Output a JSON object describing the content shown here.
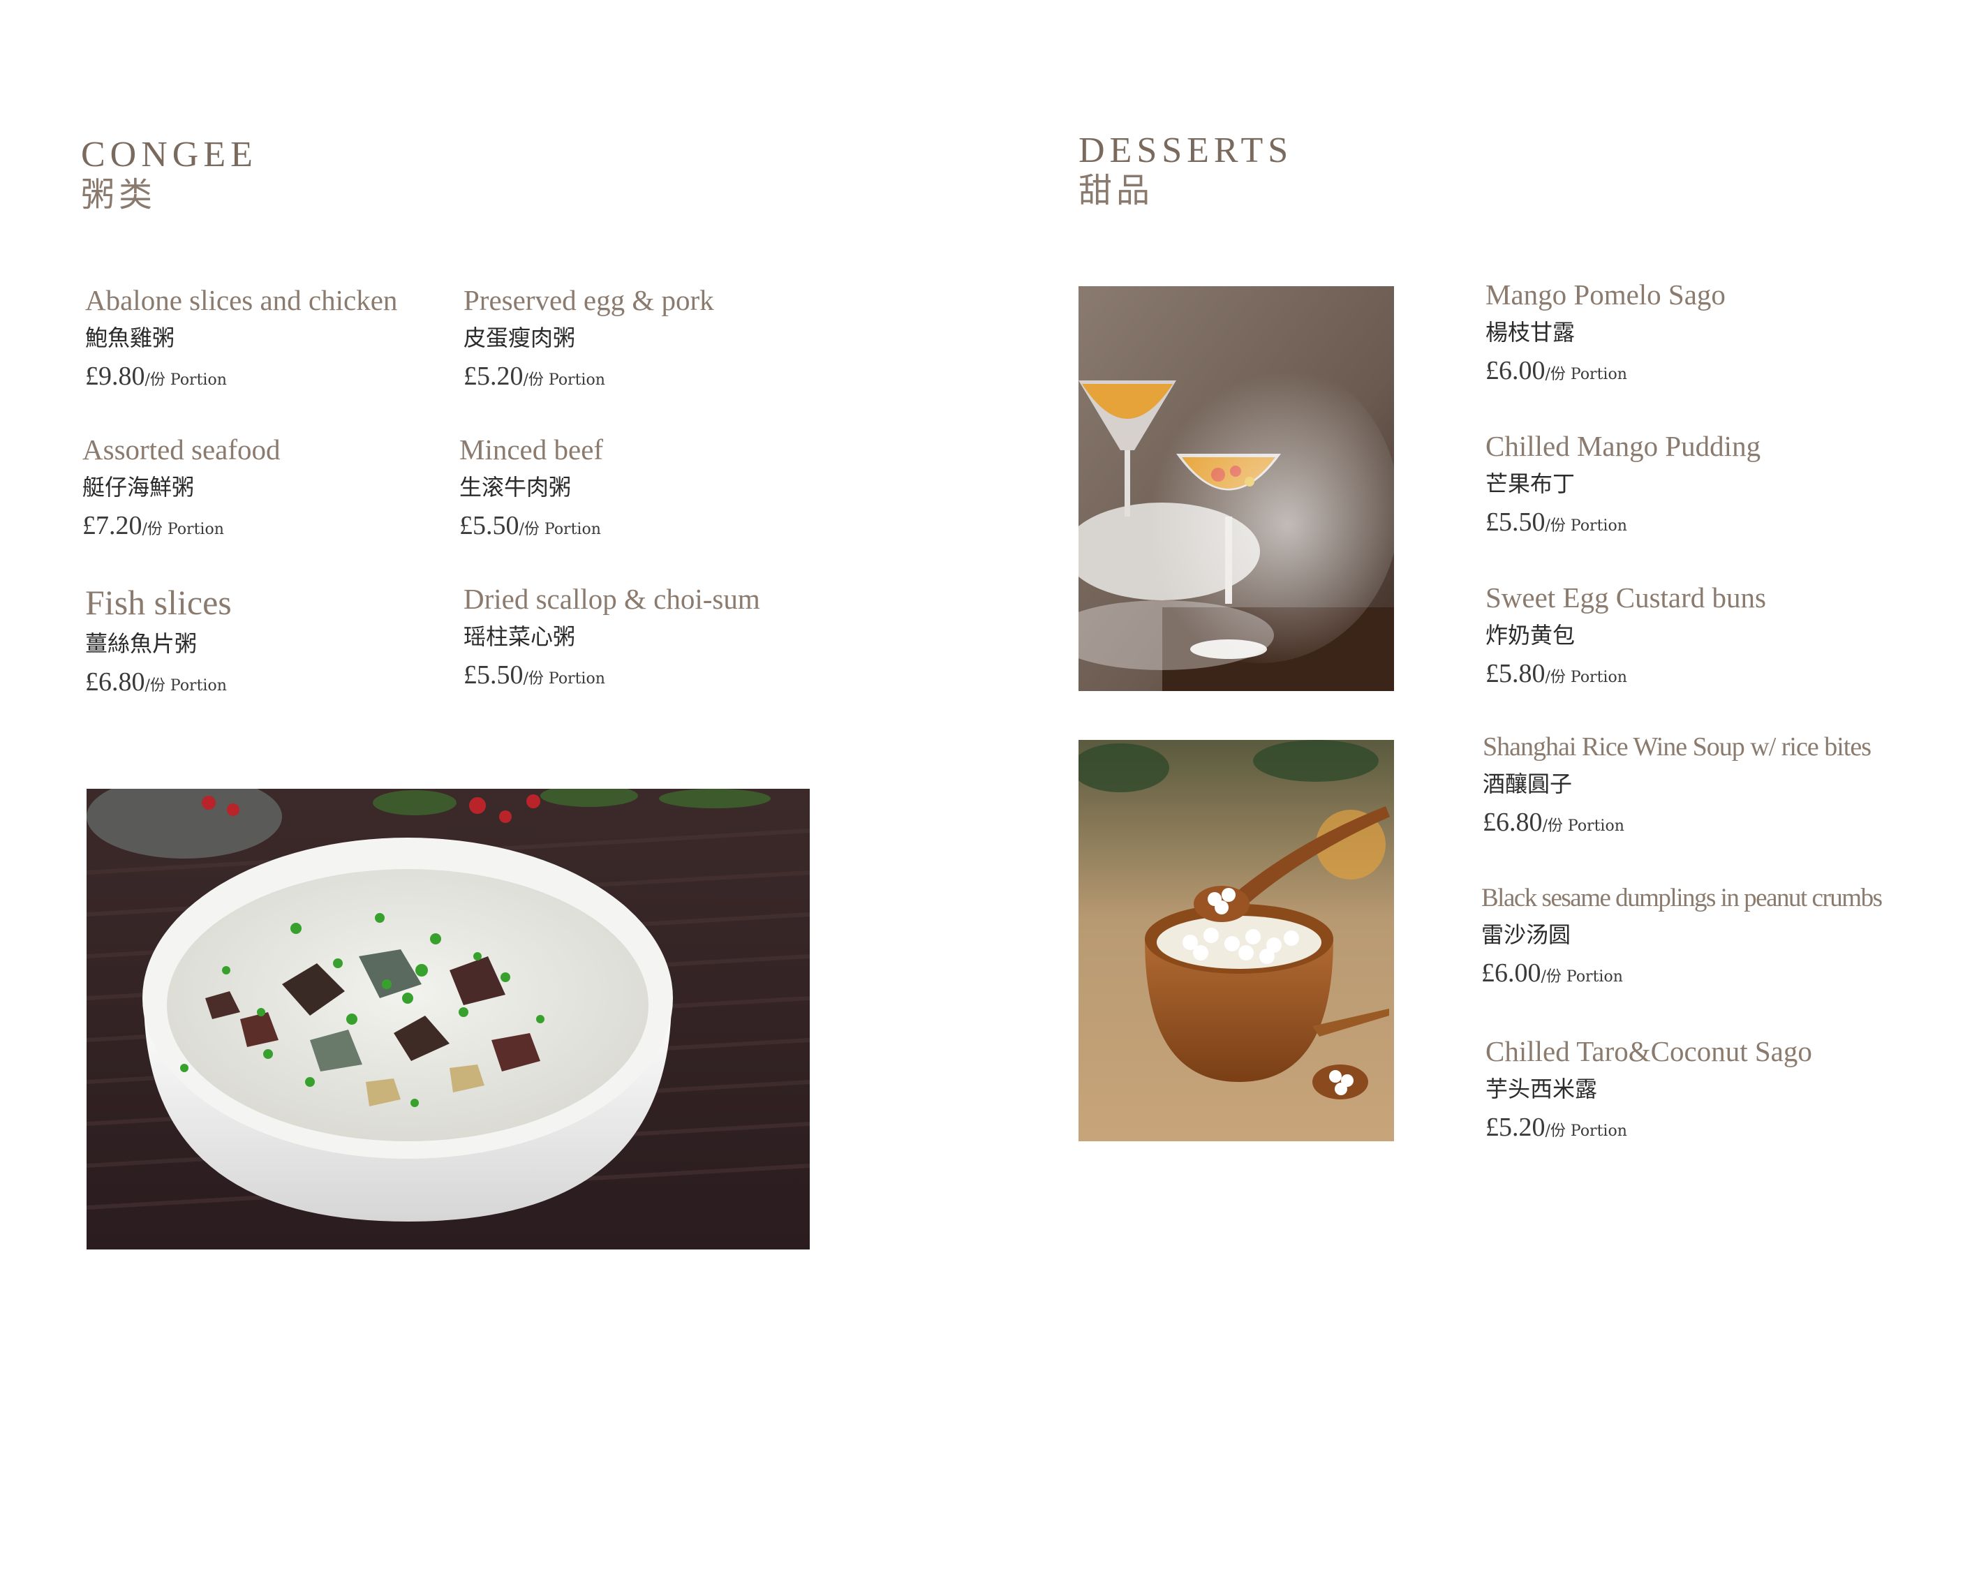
{
  "congee": {
    "title": "CONGEE",
    "title_cn": "粥类",
    "items": [
      {
        "name": "Abalone slices and chicken",
        "name_cn": "鮑魚雞粥",
        "price": "£9.80",
        "unit": "/份 Portion"
      },
      {
        "name": "Preserved egg & pork",
        "name_cn": "皮蛋瘦肉粥",
        "price": "£5.20",
        "unit": "/份 Portion"
      },
      {
        "name": "Assorted seafood",
        "name_cn": "艇仔海鮮粥",
        "price": "£7.20",
        "unit": "/份 Portion"
      },
      {
        "name": "Minced beef",
        "name_cn": "生滚牛肉粥",
        "price": "£5.50",
        "unit": "/份 Portion"
      },
      {
        "name": "Fish slices",
        "name_cn": "薑絲魚片粥",
        "price": "£6.80",
        "unit": "/份 Portion"
      },
      {
        "name": "Dried scallop & choi-sum",
        "name_cn": "瑶柱菜心粥",
        "price": "£5.50",
        "unit": "/份 Portion"
      }
    ]
  },
  "desserts": {
    "title": "DESSERTS",
    "title_cn": "甜品",
    "items": [
      {
        "name": "Mango Pomelo Sago",
        "name_cn": "楊枝甘露",
        "price": "£6.00",
        "unit": "/份 Portion"
      },
      {
        "name": "Chilled Mango Pudding",
        "name_cn": "芒果布丁",
        "price": "£5.50",
        "unit": "/份 Portion"
      },
      {
        "name": "Sweet Egg Custard buns",
        "name_cn": "炸奶黄包",
        "price": "£5.80",
        "unit": "/份 Portion"
      },
      {
        "name": "Shanghai Rice Wine Soup w/ rice bites",
        "name_cn": "酒釀圓子",
        "price": "£6.80",
        "unit": "/份 Portion"
      },
      {
        "name": "Black sesame dumplings in peanut crumbs",
        "name_cn": "雷沙汤圆",
        "price": "£6.00",
        "unit": "/份 Portion"
      },
      {
        "name": "Chilled Taro&Coconut Sago",
        "name_cn": "芋头西米露",
        "price": "£5.20",
        "unit": "/份 Portion"
      }
    ]
  },
  "colors": {
    "heading": "#7a6a5d",
    "item_name": "#8b7b6e",
    "chinese_text": "#2b2b2b",
    "price": "#3a3a3a"
  },
  "images": {
    "congee_photo": "century-egg-congee-bowl",
    "dessert_photo_1": "mango-pomelo-sago-glasses",
    "dessert_photo_2": "rice-wine-soup-wooden-bowl"
  }
}
